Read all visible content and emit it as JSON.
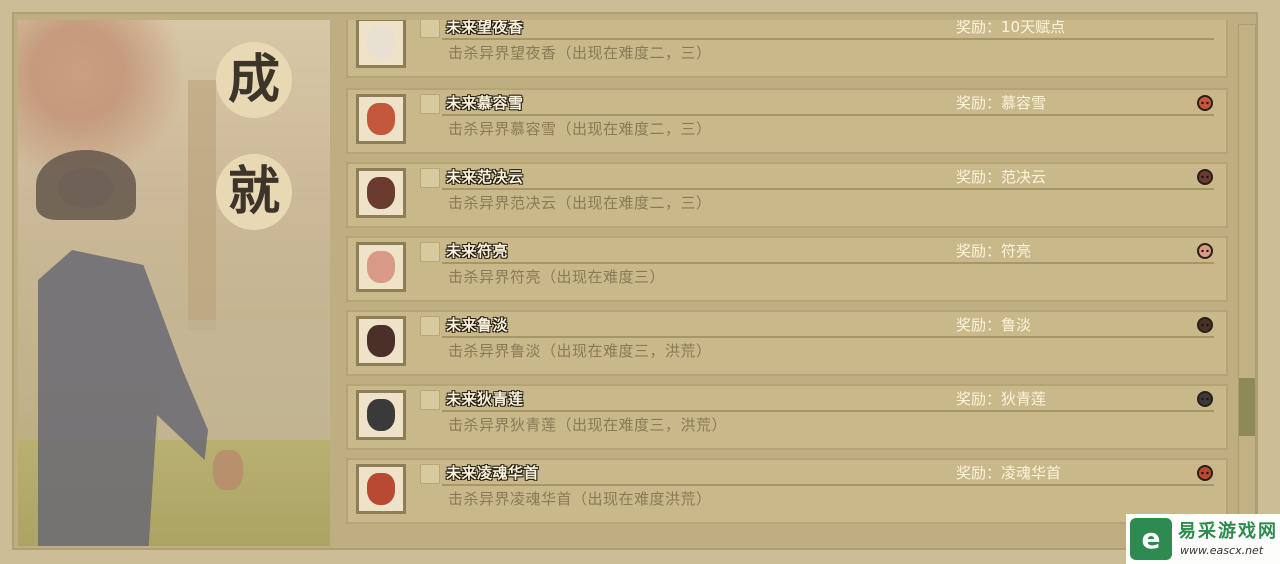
{
  "page": {
    "title_chars": [
      "成",
      "就"
    ]
  },
  "achievements": [
    {
      "name": "未来望夜香",
      "desc": "击杀异界望夜香（出现在难度二，三）",
      "reward": "奖励：10天赋点",
      "portrait_icon": "fox-face-icon",
      "reward_icon": null,
      "face_color": "#e8e0d0"
    },
    {
      "name": "未来慕容雪",
      "desc": "击杀异界慕容雪（出现在难度二，三）",
      "reward": "奖励：慕容雪",
      "portrait_icon": "girl-portrait-icon",
      "reward_icon": "girl-head-icon",
      "face_color": "#c4583b"
    },
    {
      "name": "未来范决云",
      "desc": "击杀异界范决云（出现在难度二，三）",
      "reward": "奖励：范决云",
      "portrait_icon": "bearded-man-portrait-icon",
      "reward_icon": "man-head-icon",
      "face_color": "#6b3b30"
    },
    {
      "name": "未来符亮",
      "desc": "击杀异界符亮（出现在难度三）",
      "reward": "奖励：符亮",
      "portrait_icon": "pig-face-portrait-icon",
      "reward_icon": "pig-head-icon",
      "face_color": "#d99a88"
    },
    {
      "name": "未来鲁淡",
      "desc": "击杀异界鲁淡（出现在难度三，洪荒）",
      "reward": "奖励：鲁淡",
      "portrait_icon": "bald-bandit-portrait-icon",
      "reward_icon": "bandit-head-icon",
      "face_color": "#4a3028"
    },
    {
      "name": "未来狄青莲",
      "desc": "击杀异界狄青莲（出现在难度三，洪荒）",
      "reward": "奖励：狄青莲",
      "portrait_icon": "hat-swordsman-portrait-icon",
      "reward_icon": "hat-head-icon",
      "face_color": "#3a3a3a"
    },
    {
      "name": "未来凌魂华首",
      "desc": "击杀异界凌魂华首（出现在难度洪荒）",
      "reward": "奖励：凌魂华首",
      "portrait_icon": "red-haired-portrait-icon",
      "reward_icon": "red-head-icon",
      "face_color": "#b84a34"
    }
  ],
  "scroll": {
    "position_fraction": 0.7
  },
  "watermark": {
    "badge": "e",
    "cn": "易采游戏网",
    "url": "www.eascx.net"
  },
  "colors": {
    "card_bg": "#c9b88a",
    "name_text": "#faf1d8",
    "desc_text": "#8a7a57",
    "reward_text": "#fbf4dc",
    "watermark_green": "#2e8b4f"
  }
}
